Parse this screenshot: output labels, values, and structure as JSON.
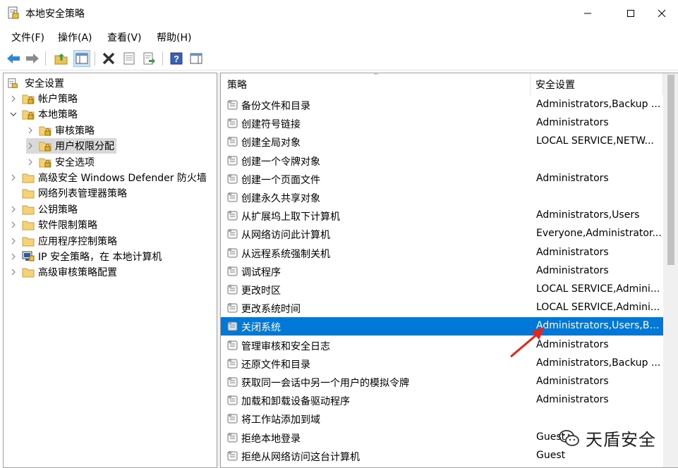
{
  "window": {
    "title": "本地安全策略",
    "minimize_icon": "minimize-icon",
    "maximize_icon": "maximize-icon",
    "close_icon": "close-icon"
  },
  "menu": [
    "文件(F)",
    "操作(A)",
    "查看(V)",
    "帮助(H)"
  ],
  "toolbar": [
    "back-arrow-icon",
    "forward-arrow-icon",
    "up-folder-icon",
    "show-hide-tree-icon",
    "delete-icon",
    "properties-icon",
    "export-list-icon",
    "help-icon",
    "action-pane-icon"
  ],
  "tree": {
    "root": "安全设置",
    "items": [
      {
        "label": "帐户策略",
        "level": 1,
        "expander": "collapsed",
        "icon": "lock-folder-icon"
      },
      {
        "label": "本地策略",
        "level": 1,
        "expander": "expanded",
        "icon": "lock-folder-icon"
      },
      {
        "label": "审核策略",
        "level": 2,
        "expander": "collapsed",
        "icon": "lock-folder-icon"
      },
      {
        "label": "用户权限分配",
        "level": 2,
        "expander": "collapsed",
        "icon": "lock-folder-icon",
        "selected": true
      },
      {
        "label": "安全选项",
        "level": 2,
        "expander": "collapsed",
        "icon": "lock-folder-icon"
      },
      {
        "label": "高级安全 Windows Defender 防火墙",
        "level": 1,
        "expander": "collapsed",
        "icon": "folder-icon"
      },
      {
        "label": "网络列表管理器策略",
        "level": 1,
        "expander": "none",
        "icon": "folder-icon"
      },
      {
        "label": "公钥策略",
        "level": 1,
        "expander": "collapsed",
        "icon": "folder-icon"
      },
      {
        "label": "软件限制策略",
        "level": 1,
        "expander": "collapsed",
        "icon": "folder-icon"
      },
      {
        "label": "应用程序控制策略",
        "level": 1,
        "expander": "collapsed",
        "icon": "folder-icon"
      },
      {
        "label": "IP 安全策略，在 本地计算机",
        "level": 1,
        "expander": "collapsed",
        "icon": "ip-security-icon"
      },
      {
        "label": "高级审核策略配置",
        "level": 1,
        "expander": "collapsed",
        "icon": "folder-icon"
      }
    ]
  },
  "list": {
    "col_policy": "策略",
    "col_setting": "安全设置",
    "rows": [
      {
        "policy": "备份文件和目录",
        "setting": "Administrators,Backup ..."
      },
      {
        "policy": "创建符号链接",
        "setting": "Administrators"
      },
      {
        "policy": "创建全局对象",
        "setting": "LOCAL SERVICE,NETW..."
      },
      {
        "policy": "创建一个令牌对象",
        "setting": ""
      },
      {
        "policy": "创建一个页面文件",
        "setting": "Administrators"
      },
      {
        "policy": "创建永久共享对象",
        "setting": ""
      },
      {
        "policy": "从扩展坞上取下计算机",
        "setting": "Administrators,Users"
      },
      {
        "policy": "从网络访问此计算机",
        "setting": "Everyone,Administrator..."
      },
      {
        "policy": "从远程系统强制关机",
        "setting": "Administrators"
      },
      {
        "policy": "调试程序",
        "setting": "Administrators"
      },
      {
        "policy": "更改时区",
        "setting": "LOCAL SERVICE,Admini..."
      },
      {
        "policy": "更改系统时间",
        "setting": "LOCAL SERVICE,Admini..."
      },
      {
        "policy": "关闭系统",
        "setting": "Administrators,Users,Ba...",
        "selected": true
      },
      {
        "policy": "管理审核和安全日志",
        "setting": "Administrators"
      },
      {
        "policy": "还原文件和目录",
        "setting": "Administrators,Backup ..."
      },
      {
        "policy": "获取同一会话中另一个用户的模拟令牌",
        "setting": "Administrators"
      },
      {
        "policy": "加载和卸载设备驱动程序",
        "setting": "Administrators"
      },
      {
        "policy": "将工作站添加到域",
        "setting": ""
      },
      {
        "policy": "拒绝本地登录",
        "setting": "Guest"
      },
      {
        "policy": "拒绝从网络访问这台计算机",
        "setting": "Guest"
      }
    ]
  },
  "annotation": {
    "arrow_color": "#e8231a"
  },
  "watermark": {
    "text": "天盾安全",
    "icon": "wechat-icon"
  },
  "colors": {
    "selection": "#0078d7",
    "tree_selected": "#d9d9d9"
  }
}
